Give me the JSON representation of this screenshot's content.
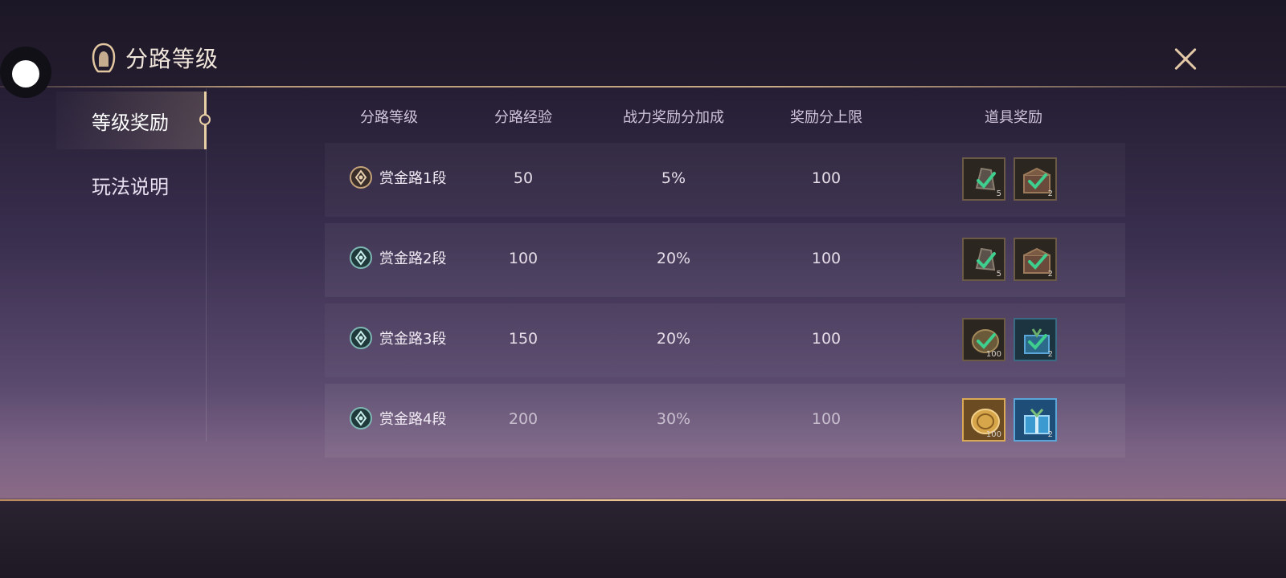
{
  "header": {
    "title": "分路等级"
  },
  "sidebar": {
    "items": [
      {
        "label": "等级奖励"
      },
      {
        "label": "玩法说明"
      }
    ]
  },
  "table": {
    "columns": [
      "分路等级",
      "分路经验",
      "战力奖励分加成",
      "奖励分上限",
      "道具奖励"
    ],
    "rows": [
      {
        "rank": "赏金路1段",
        "exp": "50",
        "bonus": "5%",
        "cap": "100",
        "rewards": [
          {
            "icon": "token-icon",
            "count": "5",
            "claimed": true
          },
          {
            "icon": "treasure-chest-icon",
            "count": "2",
            "claimed": true
          }
        ]
      },
      {
        "rank": "赏金路2段",
        "exp": "100",
        "bonus": "20%",
        "cap": "100",
        "rewards": [
          {
            "icon": "token-icon",
            "count": "5",
            "claimed": true
          },
          {
            "icon": "treasure-chest-icon",
            "count": "2",
            "claimed": true
          }
        ]
      },
      {
        "rank": "赏金路3段",
        "exp": "150",
        "bonus": "20%",
        "cap": "100",
        "rewards": [
          {
            "icon": "coin-icon",
            "count": "100",
            "claimed": true
          },
          {
            "icon": "gift-box-icon",
            "count": "2",
            "claimed": true
          }
        ]
      },
      {
        "rank": "赏金路4段",
        "exp": "200",
        "bonus": "30%",
        "cap": "100",
        "rewards": [
          {
            "icon": "coin-icon",
            "count": "100",
            "claimed": false
          },
          {
            "icon": "gift-box-icon",
            "count": "2",
            "claimed": false
          }
        ]
      }
    ]
  },
  "colors": {
    "accent": "#e9cfa6",
    "check": "#3ecf8e",
    "gold": "#d9a957",
    "blue": "#5aa6d8"
  }
}
